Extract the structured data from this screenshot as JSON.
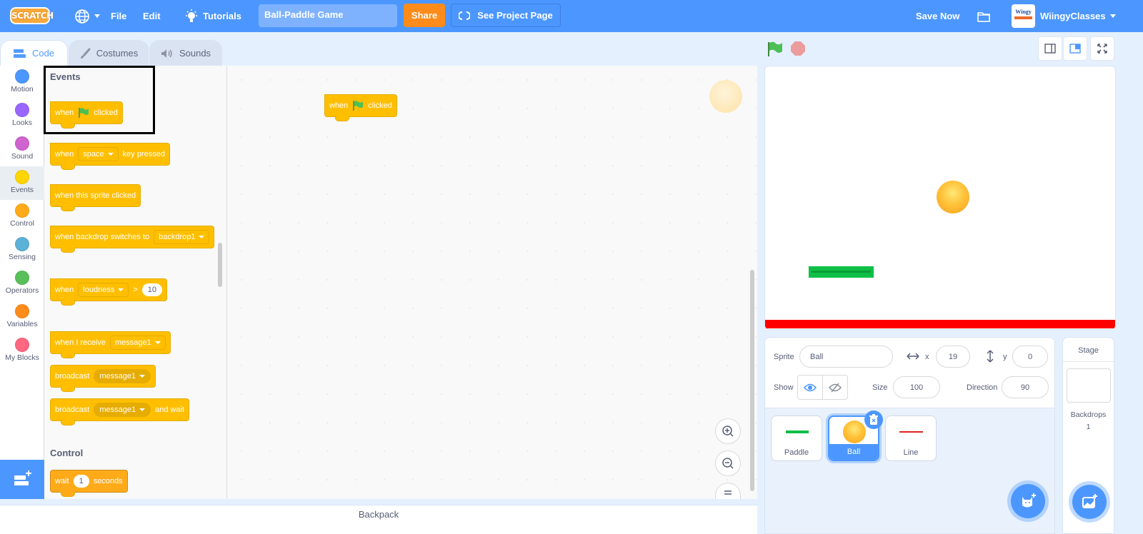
{
  "menubar": {
    "logo_text": "SCRATCH",
    "file_label": "File",
    "edit_label": "Edit",
    "tutorials_label": "Tutorials",
    "project_title": "Ball-Paddle Game",
    "share_label": "Share",
    "see_project_label": "See Project Page",
    "save_now_label": "Save Now",
    "account_name": "WiingyClasses",
    "avatar_text": "Wingy"
  },
  "tabs": [
    {
      "label": "Code",
      "active": true
    },
    {
      "label": "Costumes",
      "active": false
    },
    {
      "label": "Sounds",
      "active": false
    }
  ],
  "categories": [
    {
      "label": "Motion",
      "color": "#4c97ff"
    },
    {
      "label": "Looks",
      "color": "#9966ff"
    },
    {
      "label": "Sound",
      "color": "#cf63cf"
    },
    {
      "label": "Events",
      "color": "#ffd500",
      "selected": true
    },
    {
      "label": "Control",
      "color": "#ffab19"
    },
    {
      "label": "Sensing",
      "color": "#5cb1d6"
    },
    {
      "label": "Operators",
      "color": "#59c059"
    },
    {
      "label": "Variables",
      "color": "#ff8c1a"
    },
    {
      "label": "My Blocks",
      "color": "#ff6680"
    }
  ],
  "palette": {
    "events_heading": "Events",
    "control_heading": "Control",
    "blocks": {
      "when_flag": {
        "pre": "when",
        "post": "clicked"
      },
      "when_key": {
        "pre": "when",
        "dropdown": "space",
        "post": "key pressed"
      },
      "when_sprite_clicked": {
        "text": "when this sprite clicked"
      },
      "when_backdrop": {
        "pre": "when backdrop switches to",
        "dropdown": "backdrop1"
      },
      "when_loudness": {
        "pre": "when",
        "dropdown": "loudness",
        "op": ">",
        "value": "10"
      },
      "when_receive": {
        "pre": "when I receive",
        "dropdown": "message1"
      },
      "broadcast": {
        "pre": "broadcast",
        "dropdown": "message1"
      },
      "broadcast_wait": {
        "pre": "broadcast",
        "dropdown": "message1",
        "post": "and wait"
      },
      "wait": {
        "pre": "wait",
        "value": "1",
        "post": "seconds"
      }
    }
  },
  "workspace": {
    "script_block": {
      "pre": "when",
      "post": "clicked"
    }
  },
  "backpack_label": "Backpack",
  "sprite_info": {
    "sprite_label": "Sprite",
    "sprite_name": "Ball",
    "x_label": "x",
    "x_value": "19",
    "y_label": "y",
    "y_value": "0",
    "show_label": "Show",
    "size_label": "Size",
    "size_value": "100",
    "direction_label": "Direction",
    "direction_value": "90"
  },
  "sprites": [
    {
      "name": "Paddle",
      "selected": false,
      "thumb_color": "#0ebf46"
    },
    {
      "name": "Ball",
      "selected": true,
      "thumb_color": "#f7a21b"
    },
    {
      "name": "Line",
      "selected": false,
      "thumb_color": "#e0201f"
    }
  ],
  "stage_pane": {
    "title": "Stage",
    "backdrops_label": "Backdrops",
    "backdrops_count": "1"
  },
  "colors": {
    "accent": "#4c97ff",
    "events": "#ffbf00",
    "share": "#ff8c1a"
  }
}
